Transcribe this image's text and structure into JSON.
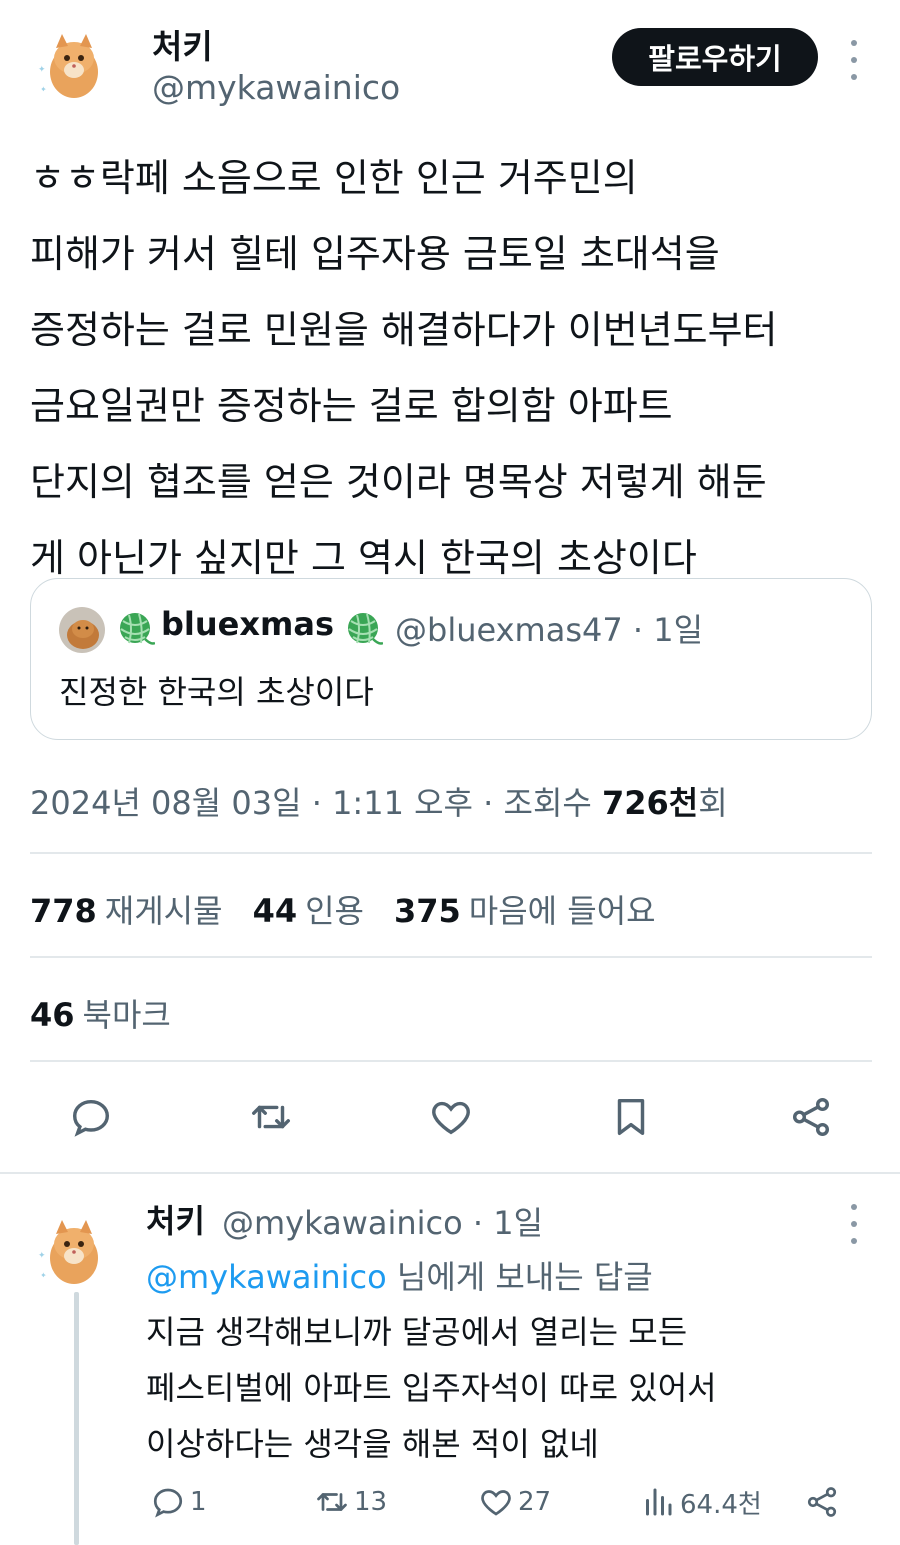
{
  "tweet": {
    "author_name": "처키",
    "author_handle": "@mykawainico",
    "follow_label": "팔로우하기",
    "body_lines": [
      "ㅎㅎ락페 소음으로 인한 인근 거주민의",
      "피해가 커서 힐테 입주자용 금토일 초대석을",
      "증정하는 걸로 민원을 해결하다가 이번년도부터",
      "금요일권만 증정하는 걸로 합의함 아파트",
      "단지의 협조를 얻은 것이라 명목상 저렇게 해둔",
      "게 아닌가 싶지만 그 역시 한국의 초상이다"
    ],
    "quote": {
      "name": "bluexmas",
      "handle": "@bluexmas47",
      "sep": "·",
      "time": "1일",
      "text": "진정한 한국의 초상이다"
    },
    "timestamp": {
      "date": "2024년 08월 03일",
      "sep1": "·",
      "time": "1:11 오후",
      "sep2": "·",
      "views_label": "조회수",
      "views_value": "726천",
      "views_suffix": "회"
    },
    "stats": {
      "reposts_value": "778",
      "reposts_label": "재게시물",
      "quotes_value": "44",
      "quotes_label": "인용",
      "likes_value": "375",
      "likes_label": "마음에 들어요",
      "bookmarks_value": "46",
      "bookmarks_label": "북마크"
    },
    "actions": [
      "reply-icon",
      "repost-icon",
      "like-icon",
      "bookmark-icon",
      "share-icon"
    ]
  },
  "reply": {
    "author_name": "처키",
    "author_handle": "@mykawainico",
    "sep": "·",
    "time": "1일",
    "reply_to_mention": "@mykawainico",
    "reply_to_suffix": " 님에게 보내는 답글",
    "body_lines": [
      "지금 생각해보니까 달공에서 열리는 모든",
      "페스티벌에 아파트 입주자석이 따로 있어서",
      "이상하다는 생각을 해본 적이 없네"
    ],
    "actions": {
      "replies": "1",
      "reposts": "13",
      "likes": "27",
      "views": "64.4천"
    }
  },
  "colors": {
    "text": "#0f1419",
    "secondary": "#536471",
    "accent": "#1d9bf0",
    "border": "#cfd9de",
    "button": "#0f1419"
  }
}
